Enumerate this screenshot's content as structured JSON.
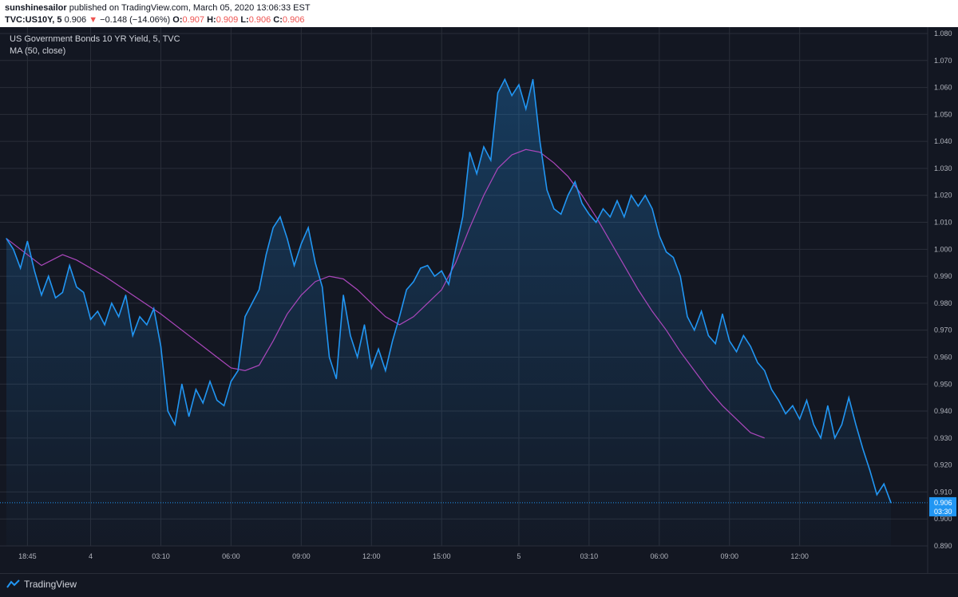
{
  "header": {
    "author": "sunshinesailor",
    "published_text": "published on TradingView.com, March 05, 2020 13:06:33 EST",
    "symbol": "TVC:US10Y, 5",
    "last": "0.906",
    "change_arrow": "▼",
    "change": "−0.148 (−14.06%)",
    "o_label": "O:",
    "o_value": "0.907",
    "h_label": "H:",
    "h_value": "0.909",
    "l_label": "L:",
    "l_value": "0.906",
    "c_label": "C:",
    "c_value": "0.906"
  },
  "legend": {
    "series_title": "US Government Bonds 10 YR Yield, 5, TVC",
    "indicator": "MA (50, close)"
  },
  "footer": {
    "brand": "TradingView"
  },
  "colors": {
    "background": "#131722",
    "price_line": "#2196f3",
    "ma_line": "#ab47bc",
    "grid": "#2a2e39",
    "down": "#ef5350",
    "last_price_badge": "#2196f3"
  },
  "chart_data": {
    "type": "area",
    "ylim": [
      0.89,
      1.08
    ],
    "yticks": [
      0.89,
      0.9,
      0.91,
      0.92,
      0.93,
      0.94,
      0.95,
      0.96,
      0.97,
      0.98,
      0.99,
      1.0,
      1.01,
      1.02,
      1.03,
      1.04,
      1.05,
      1.06,
      1.07,
      1.08
    ],
    "ytick_labels": [
      "0.890",
      "0.900",
      "0.910",
      "0.920",
      "0.930",
      "0.940",
      "0.950",
      "0.960",
      "0.970",
      "0.980",
      "0.990",
      "1.000",
      "1.010",
      "1.020",
      "1.030",
      "1.040",
      "1.050",
      "1.060",
      "1.070",
      "1.080"
    ],
    "x_tick_labels": [
      {
        "label": "18:45",
        "x": 3
      },
      {
        "label": "4",
        "x": 12
      },
      {
        "label": "03:10",
        "x": 22
      },
      {
        "label": "06:00",
        "x": 32
      },
      {
        "label": "09:00",
        "x": 42
      },
      {
        "label": "12:00",
        "x": 52
      },
      {
        "label": "15:00",
        "x": 62
      },
      {
        "label": "5",
        "x": 73
      },
      {
        "label": "03:10",
        "x": 83
      },
      {
        "label": "06:00",
        "x": 93
      },
      {
        "label": "09:00",
        "x": 103
      },
      {
        "label": "12:00",
        "x": 113
      }
    ],
    "x_range": [
      0,
      126
    ],
    "last_price": 0.906,
    "last_price_label": "0.906",
    "countdown_label": "03:30",
    "series": [
      {
        "name": "US Government Bonds 10 YR Yield",
        "points": [
          [
            0,
            1.004
          ],
          [
            1,
            1.0
          ],
          [
            2,
            0.993
          ],
          [
            3,
            1.003
          ],
          [
            4,
            0.992
          ],
          [
            5,
            0.983
          ],
          [
            6,
            0.99
          ],
          [
            7,
            0.982
          ],
          [
            8,
            0.984
          ],
          [
            9,
            0.994
          ],
          [
            10,
            0.986
          ],
          [
            11,
            0.984
          ],
          [
            12,
            0.974
          ],
          [
            13,
            0.977
          ],
          [
            14,
            0.972
          ],
          [
            15,
            0.98
          ],
          [
            16,
            0.975
          ],
          [
            17,
            0.983
          ],
          [
            18,
            0.968
          ],
          [
            19,
            0.975
          ],
          [
            20,
            0.972
          ],
          [
            21,
            0.978
          ],
          [
            22,
            0.964
          ],
          [
            23,
            0.94
          ],
          [
            24,
            0.935
          ],
          [
            25,
            0.95
          ],
          [
            26,
            0.938
          ],
          [
            27,
            0.948
          ],
          [
            28,
            0.943
          ],
          [
            29,
            0.951
          ],
          [
            30,
            0.944
          ],
          [
            31,
            0.942
          ],
          [
            32,
            0.951
          ],
          [
            33,
            0.955
          ],
          [
            34,
            0.975
          ],
          [
            35,
            0.98
          ],
          [
            36,
            0.985
          ],
          [
            37,
            0.998
          ],
          [
            38,
            1.008
          ],
          [
            39,
            1.012
          ],
          [
            40,
            1.004
          ],
          [
            41,
            0.994
          ],
          [
            42,
            1.002
          ],
          [
            43,
            1.008
          ],
          [
            44,
            0.995
          ],
          [
            45,
            0.986
          ],
          [
            46,
            0.96
          ],
          [
            47,
            0.952
          ],
          [
            48,
            0.983
          ],
          [
            49,
            0.968
          ],
          [
            50,
            0.96
          ],
          [
            51,
            0.972
          ],
          [
            52,
            0.956
          ],
          [
            53,
            0.963
          ],
          [
            54,
            0.955
          ],
          [
            55,
            0.966
          ],
          [
            56,
            0.975
          ],
          [
            57,
            0.985
          ],
          [
            58,
            0.988
          ],
          [
            59,
            0.993
          ],
          [
            60,
            0.994
          ],
          [
            61,
            0.99
          ],
          [
            62,
            0.992
          ],
          [
            63,
            0.987
          ],
          [
            64,
            1.0
          ],
          [
            65,
            1.012
          ],
          [
            66,
            1.036
          ],
          [
            67,
            1.028
          ],
          [
            68,
            1.038
          ],
          [
            69,
            1.033
          ],
          [
            70,
            1.058
          ],
          [
            71,
            1.063
          ],
          [
            72,
            1.057
          ],
          [
            73,
            1.061
          ],
          [
            74,
            1.052
          ],
          [
            75,
            1.063
          ],
          [
            76,
            1.04
          ],
          [
            77,
            1.022
          ],
          [
            78,
            1.015
          ],
          [
            79,
            1.013
          ],
          [
            80,
            1.02
          ],
          [
            81,
            1.025
          ],
          [
            82,
            1.017
          ],
          [
            83,
            1.013
          ],
          [
            84,
            1.01
          ],
          [
            85,
            1.015
          ],
          [
            86,
            1.012
          ],
          [
            87,
            1.018
          ],
          [
            88,
            1.012
          ],
          [
            89,
            1.02
          ],
          [
            90,
            1.016
          ],
          [
            91,
            1.02
          ],
          [
            92,
            1.015
          ],
          [
            93,
            1.005
          ],
          [
            94,
            0.999
          ],
          [
            95,
            0.997
          ],
          [
            96,
            0.99
          ],
          [
            97,
            0.975
          ],
          [
            98,
            0.97
          ],
          [
            99,
            0.977
          ],
          [
            100,
            0.968
          ],
          [
            101,
            0.965
          ],
          [
            102,
            0.976
          ],
          [
            103,
            0.966
          ],
          [
            104,
            0.962
          ],
          [
            105,
            0.968
          ],
          [
            106,
            0.964
          ],
          [
            107,
            0.958
          ],
          [
            108,
            0.955
          ],
          [
            109,
            0.948
          ],
          [
            110,
            0.944
          ],
          [
            111,
            0.939
          ],
          [
            112,
            0.942
          ],
          [
            113,
            0.937
          ],
          [
            114,
            0.944
          ],
          [
            115,
            0.935
          ],
          [
            116,
            0.93
          ],
          [
            117,
            0.942
          ],
          [
            118,
            0.93
          ],
          [
            119,
            0.935
          ],
          [
            120,
            0.945
          ],
          [
            121,
            0.935
          ],
          [
            122,
            0.926
          ],
          [
            123,
            0.918
          ],
          [
            124,
            0.909
          ],
          [
            125,
            0.913
          ],
          [
            126,
            0.906
          ]
        ]
      },
      {
        "name": "MA (50, close)",
        "points": [
          [
            0,
            1.004
          ],
          [
            3,
            0.998
          ],
          [
            5,
            0.994
          ],
          [
            8,
            0.998
          ],
          [
            10,
            0.996
          ],
          [
            14,
            0.99
          ],
          [
            18,
            0.983
          ],
          [
            22,
            0.976
          ],
          [
            26,
            0.968
          ],
          [
            30,
            0.96
          ],
          [
            32,
            0.956
          ],
          [
            34,
            0.955
          ],
          [
            36,
            0.957
          ],
          [
            38,
            0.966
          ],
          [
            40,
            0.976
          ],
          [
            42,
            0.983
          ],
          [
            44,
            0.988
          ],
          [
            46,
            0.99
          ],
          [
            48,
            0.989
          ],
          [
            50,
            0.985
          ],
          [
            52,
            0.98
          ],
          [
            54,
            0.975
          ],
          [
            56,
            0.972
          ],
          [
            58,
            0.975
          ],
          [
            60,
            0.98
          ],
          [
            62,
            0.985
          ],
          [
            64,
            0.995
          ],
          [
            66,
            1.008
          ],
          [
            68,
            1.02
          ],
          [
            70,
            1.03
          ],
          [
            72,
            1.035
          ],
          [
            74,
            1.037
          ],
          [
            76,
            1.036
          ],
          [
            78,
            1.032
          ],
          [
            80,
            1.027
          ],
          [
            82,
            1.02
          ],
          [
            84,
            1.012
          ],
          [
            86,
            1.003
          ],
          [
            88,
            0.994
          ],
          [
            90,
            0.985
          ],
          [
            92,
            0.977
          ],
          [
            94,
            0.97
          ],
          [
            96,
            0.962
          ],
          [
            98,
            0.955
          ],
          [
            100,
            0.948
          ],
          [
            102,
            0.942
          ],
          [
            104,
            0.937
          ],
          [
            106,
            0.932
          ],
          [
            108,
            0.93
          ]
        ]
      }
    ]
  }
}
